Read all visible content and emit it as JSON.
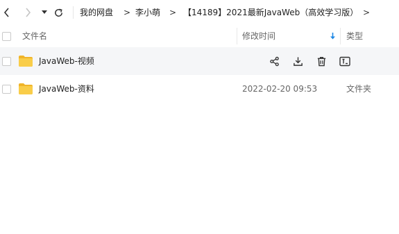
{
  "toolbar": {
    "icons": [
      "chevron-left-icon",
      "chevron-right-icon",
      "caret-down-icon",
      "refresh-icon"
    ],
    "breadcrumb": [
      {
        "label": "我的网盘"
      },
      {
        "label": "李小萌"
      },
      {
        "label": "【14189】2021最新JavaWeb（高效学习版）"
      }
    ],
    "separator": ">"
  },
  "table": {
    "columns": {
      "name": "文件名",
      "modified": "修改时间",
      "type": "类型"
    },
    "sort_icon": "arrow-down-icon",
    "rows": [
      {
        "name": "JavaWeb-视频",
        "modified": "",
        "type": "",
        "hovered": true,
        "actions": [
          "share-icon",
          "download-icon",
          "delete-icon",
          "rename-icon"
        ]
      },
      {
        "name": "JavaWeb-资料",
        "modified": "2022-02-20 09:53",
        "type": "文件夹",
        "hovered": false
      }
    ]
  },
  "colors": {
    "folder": "#f9cd49",
    "folder_back": "#f0b429",
    "accent": "#1e88e5",
    "hover_row": "#f5f6f8"
  }
}
